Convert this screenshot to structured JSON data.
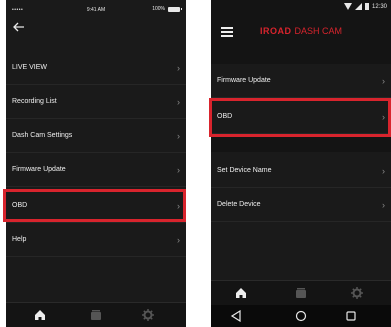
{
  "ios": {
    "status": {
      "carrier": "••••• ",
      "time": "9:41 AM",
      "battery": "100%"
    },
    "menu": [
      {
        "label": "LIVE VIEW"
      },
      {
        "label": "Recording List"
      },
      {
        "label": "Dash Cam Settings"
      },
      {
        "label": "Firmware Update"
      },
      {
        "label": "OBD"
      },
      {
        "label": "Help"
      }
    ],
    "tabs": [
      {
        "icon": "home-icon"
      },
      {
        "icon": "recording-icon"
      },
      {
        "icon": "gear-icon"
      }
    ]
  },
  "android": {
    "status": {
      "time": "12:30"
    },
    "logo": {
      "brand": "IROAD",
      "sub": "DASH CAM"
    },
    "menu_group1": [
      {
        "label": "Firmware Update"
      },
      {
        "label": "OBD"
      }
    ],
    "menu_group2": [
      {
        "label": "Set Device Name"
      },
      {
        "label": "Delete Device"
      }
    ],
    "tabs": [
      {
        "icon": "home-icon"
      },
      {
        "icon": "recording-icon"
      },
      {
        "icon": "gear-icon"
      }
    ],
    "nav": [
      {
        "icon": "back-triangle-icon"
      },
      {
        "icon": "home-circle-icon"
      },
      {
        "icon": "recents-square-icon"
      }
    ]
  },
  "colors": {
    "accent": "#d8242d",
    "background": "#1a1a1a",
    "text": "#f0f0f0"
  }
}
